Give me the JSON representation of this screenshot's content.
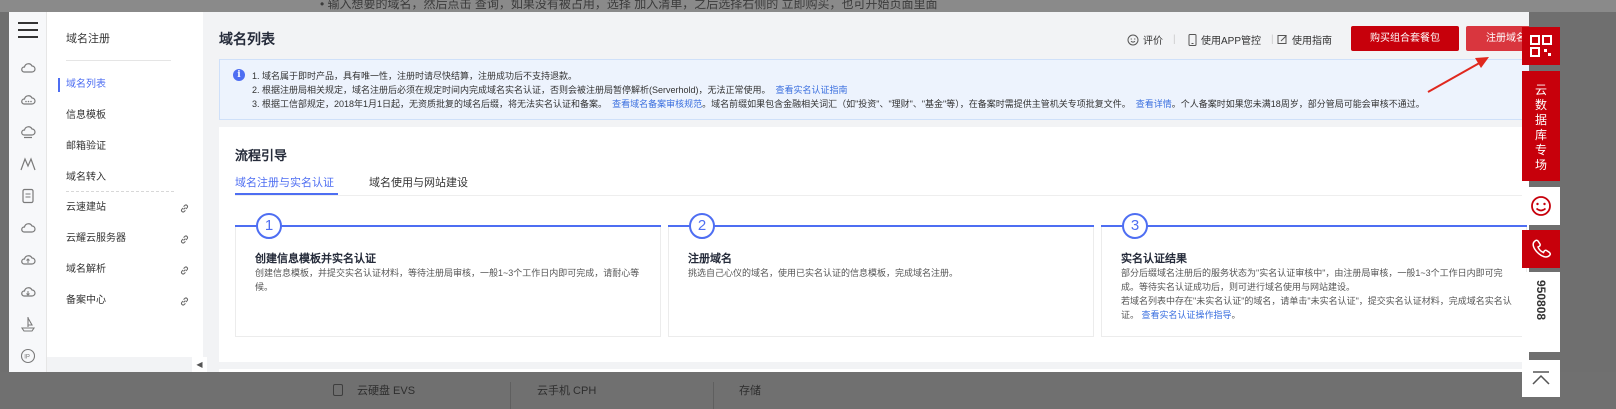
{
  "background": {
    "top_text": "• 输入想要的域名，然后点击 查询，如果没有被占用，选择 加入清单，之后选择右侧的 立即购买，也可开始页面里面",
    "bottom_cards": [
      "云硬盘 EVS",
      "云手机 CPH",
      "存储"
    ]
  },
  "rail": {
    "icons": [
      "menu-icon",
      "cloud-icon",
      "cloud-dots-icon",
      "cloud-server-icon",
      "mountain-icon",
      "document-icon",
      "cloud-outline-icon",
      "cloud-up-icon",
      "cloud-down-icon",
      "ship-icon",
      "ip-icon"
    ]
  },
  "nav": {
    "title": "域名注册",
    "items": [
      {
        "label": "域名列表",
        "active": true,
        "link": false
      },
      {
        "label": "信息模板",
        "active": false,
        "link": false
      },
      {
        "label": "邮箱验证",
        "active": false,
        "link": false
      },
      {
        "label": "域名转入",
        "active": false,
        "link": false
      },
      {
        "label": "云速建站",
        "active": false,
        "link": true
      },
      {
        "label": "云耀云服务器",
        "active": false,
        "link": true
      },
      {
        "label": "域名解析",
        "active": false,
        "link": true
      },
      {
        "label": "备案中心",
        "active": false,
        "link": true
      }
    ]
  },
  "header": {
    "title": "域名列表",
    "rate": "评价",
    "app_manage": "使用APP管控",
    "guide": "使用指南",
    "buy_combo": "购买组合套餐包",
    "register": "注册域名"
  },
  "notice": {
    "line1": "1. 域名属于即时产品，具有唯一性，注册时请尽快结算，注册成功后不支持退款。",
    "line2": "2. 根据注册局相关规定，域名注册后必须在规定时间内完成域名实名认证，否则会被注册局暂停解析(Serverhold)，无法正常使用。",
    "line2_link": "查看实名认证指南",
    "line3a": "3. 根据工信部规定，2018年1月1日起，无资质批复的域名后缀，将无法实名认证和备案。",
    "line3_link1": "查看域名备案审核规范",
    "line3b": "。域名前缀如果包含金融相关词汇（如\"投资\"、\"理财\"、\"基金\"等），在备案时需提供主管机关专项批复文件。",
    "line3_link2": "查看详情",
    "line3c": "。个人备案时如果您未满18周岁，部分管局可能会审核不通过。"
  },
  "flow": {
    "title": "流程引导",
    "tabs": [
      "域名注册与实名认证",
      "域名使用与网站建设"
    ],
    "steps": [
      {
        "num": "1",
        "title": "创建信息模板并实名认证",
        "desc": "创建信息模板，并提交实名认证材料，等待注册局审核，一般1~3个工作日内即可完成，请耐心等候。"
      },
      {
        "num": "2",
        "title": "注册域名",
        "desc": "挑选自己心仪的域名，使用已实名认证的信息模板，完成域名注册。"
      },
      {
        "num": "3",
        "title": "实名认证结果",
        "desc": "部分后缀域名注册后的服务状态为\"实名认证审核中\"，由注册局审核，一般1~3个工作日内即可完成。等待实名认证成功后，则可进行域名使用与网站建设。",
        "desc2": "若域名列表中存在\"未实名认证\"的域名，请单击\"未实名认证\"，提交实名认证材料，完成域名实名认证。",
        "link": "查看实名认证操作指导",
        "tail": "。"
      }
    ]
  },
  "float": {
    "db_label": "云数据库专场",
    "phone_number": "950808"
  },
  "colors": {
    "accent": "#4e6ef2",
    "brand_red": "#c7000b",
    "notice_bg": "#edf3fd",
    "link": "#3a6fdf"
  }
}
